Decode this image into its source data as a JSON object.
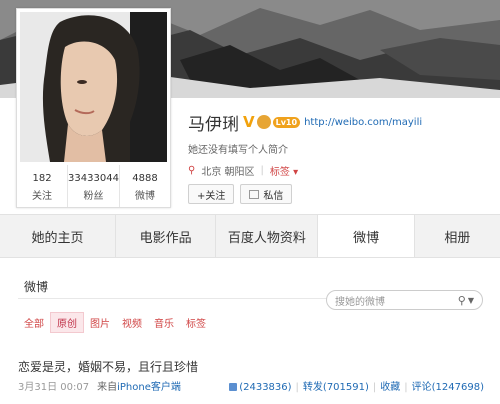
{
  "profile": {
    "name": "马伊琍",
    "v_badge": "V",
    "level": "Lv10",
    "url": "http://weibo.com/mayili",
    "bio": "她还没有填写个人简介",
    "location": "北京 朝阳区",
    "tag_label": "标签",
    "follow_label": "+关注",
    "message_label": "私信"
  },
  "stats": [
    {
      "value": "182",
      "label": "关注"
    },
    {
      "value": "33433044",
      "label": "粉丝"
    },
    {
      "value": "4888",
      "label": "微博"
    }
  ],
  "tabs": [
    "她的主页",
    "电影作品",
    "百度人物资料",
    "微博",
    "相册"
  ],
  "active_tab": "微博",
  "weibo": {
    "title": "微博",
    "search_placeholder": "搜她的微博",
    "filters": [
      "全部",
      "原创",
      "图片",
      "视频",
      "音乐",
      "标签"
    ],
    "active_filter": "原创"
  },
  "post": {
    "text": "恋爱是灵，婚姻不易，且行且珍惜",
    "time": "3月31日 00:07",
    "source_prefix": "来自",
    "source": "iPhone客户端",
    "likes": "(2433836)",
    "repost": "转发(701591)",
    "favorite": "收藏",
    "comment": "评论(1247698)"
  },
  "colors": {
    "accent": "#d04444",
    "link": "#1f6ab4"
  }
}
